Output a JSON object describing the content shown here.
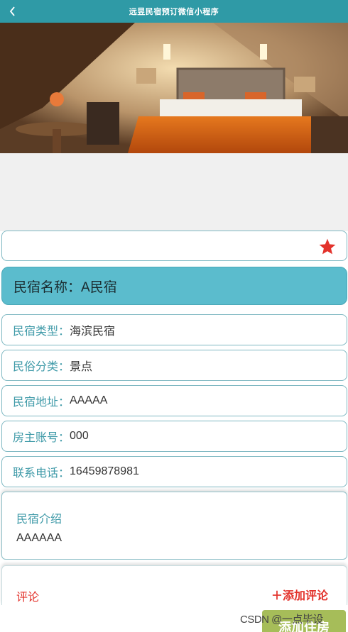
{
  "navbar": {
    "title": "远昱民宿预订微信小程序",
    "back_icon": "chevron-left-icon"
  },
  "banner": {
    "image": "hotel-room-photo"
  },
  "favorite": {
    "icon": "star-icon",
    "color": "#e3322b"
  },
  "homestay": {
    "name_label": "民宿名称：",
    "name_value": "A民宿"
  },
  "info": [
    {
      "label": "民宿类型：",
      "value": "海滨民宿"
    },
    {
      "label": "民俗分类：",
      "value": "景点"
    },
    {
      "label": "民宿地址：",
      "value": "AAAAA"
    },
    {
      "label": "房主账号：",
      "value": "000"
    },
    {
      "label": "联系电话：",
      "value": "16459878981"
    }
  ],
  "intro": {
    "heading": "民宿介绍",
    "content": "AAAAAA"
  },
  "comments": {
    "label": "评论",
    "add_label": "＋添加评论"
  },
  "floating_button": {
    "label": "添加住房"
  },
  "watermark": "CSDN @一点毕设",
  "colors": {
    "nav": "#2f9aa6",
    "accent": "#5bbccd",
    "label": "#3f9aa8",
    "red": "#e3322b"
  }
}
